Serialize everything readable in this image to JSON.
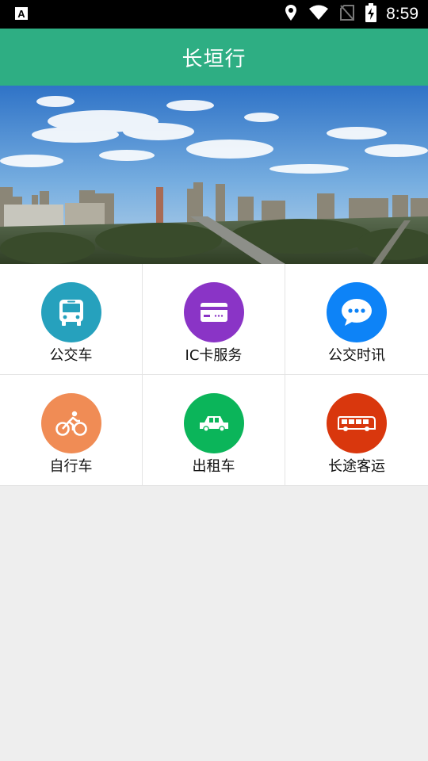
{
  "status_bar": {
    "time": "8:59",
    "icons": [
      "app-notification-icon",
      "location-icon",
      "wifi-icon",
      "no-sim-icon",
      "battery-charging-icon"
    ]
  },
  "app_bar": {
    "title": "长垣行",
    "color": "#2eae83"
  },
  "banner": {
    "description_icon": "city-skyline-photo"
  },
  "services": [
    {
      "label": "公交车",
      "icon": "bus-icon",
      "color": "#26a1bd"
    },
    {
      "label": "IC卡服务",
      "icon": "card-icon",
      "color": "#8a34c6"
    },
    {
      "label": "公交时讯",
      "icon": "chat-bubble-icon",
      "color": "#0d83f7"
    },
    {
      "label": "自行车",
      "icon": "bicycle-icon",
      "color": "#f08c55"
    },
    {
      "label": "出租车",
      "icon": "taxi-icon",
      "color": "#0bb55a"
    },
    {
      "label": "长途客运",
      "icon": "coach-icon",
      "color": "#d9370d"
    }
  ]
}
